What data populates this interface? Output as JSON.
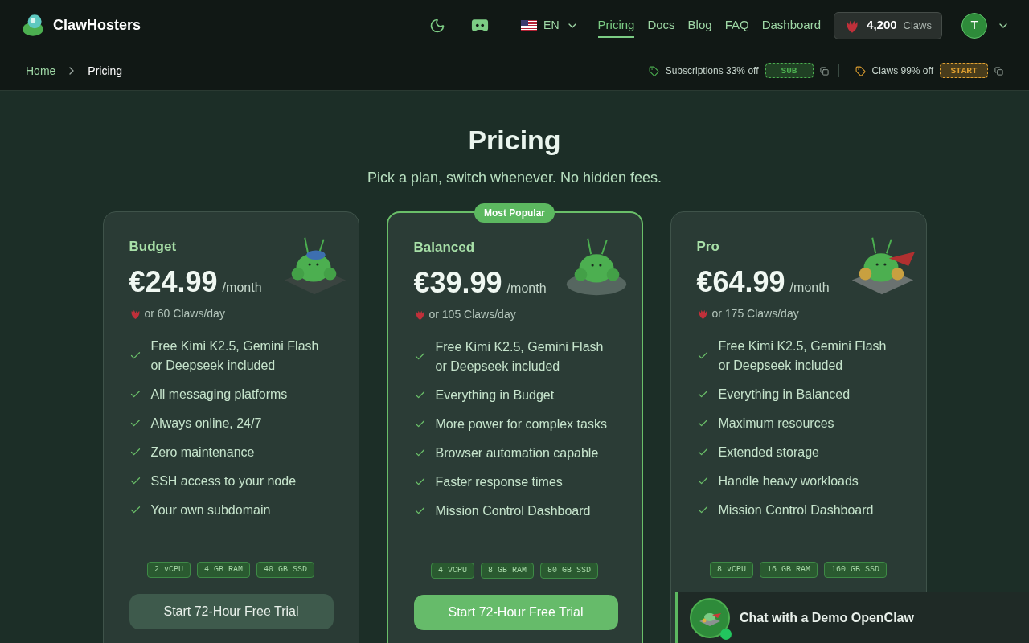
{
  "brand": {
    "name": "ClawHosters"
  },
  "language": {
    "code": "EN"
  },
  "nav": [
    {
      "label": "Pricing",
      "selected": true
    },
    {
      "label": "Docs",
      "selected": false
    },
    {
      "label": "Blog",
      "selected": false
    },
    {
      "label": "FAQ",
      "selected": false
    },
    {
      "label": "Dashboard",
      "selected": false
    }
  ],
  "balance": {
    "amount": "4,200",
    "unit": "Claws"
  },
  "avatar": {
    "initial": "T"
  },
  "breadcrumb": [
    {
      "label": "Home",
      "current": false
    },
    {
      "label": "Pricing",
      "current": true
    }
  ],
  "promos": [
    {
      "label": "Subscriptions 33% off",
      "code": "SUB",
      "color": "#4caf50"
    },
    {
      "label": "Claws 99% off",
      "code": "START",
      "color": "#e0a030"
    }
  ],
  "hero": {
    "title": "Pricing",
    "subtitle": "Pick a plan, switch whenever. No hidden fees."
  },
  "plans": [
    {
      "name": "Budget",
      "featured": false,
      "price": "€24.99",
      "period": "/month",
      "claws": "or 60 Claws/day",
      "features": [
        "Free Kimi K2.5, Gemini Flash or Deepseek included",
        "All messaging platforms",
        "Always online, 24/7",
        "Zero maintenance",
        "SSH access to your node",
        "Your own subdomain"
      ],
      "specs": [
        "2 vCPU",
        "4 GB RAM",
        "40 GB SSD"
      ],
      "button": "Start 72-Hour Free Trial"
    },
    {
      "name": "Balanced",
      "featured": true,
      "badge": "Most Popular",
      "price": "€39.99",
      "period": "/month",
      "claws": "or 105 Claws/day",
      "features": [
        "Free Kimi K2.5, Gemini Flash or Deepseek included",
        "Everything in Budget",
        "More power for complex tasks",
        "Browser automation capable",
        "Faster response times",
        "Mission Control Dashboard"
      ],
      "specs": [
        "4 vCPU",
        "8 GB RAM",
        "80 GB SSD"
      ],
      "button": "Start 72-Hour Free Trial"
    },
    {
      "name": "Pro",
      "featured": false,
      "price": "€64.99",
      "period": "/month",
      "claws": "or 175 Claws/day",
      "features": [
        "Free Kimi K2.5, Gemini Flash or Deepseek included",
        "Everything in Balanced",
        "Maximum resources",
        "Extended storage",
        "Handle heavy workloads",
        "Mission Control Dashboard"
      ],
      "specs": [
        "8 vCPU",
        "16 GB RAM",
        "160 GB SSD"
      ]
    }
  ],
  "chat": {
    "label": "Chat with a Demo OpenClaw",
    "online": true
  }
}
